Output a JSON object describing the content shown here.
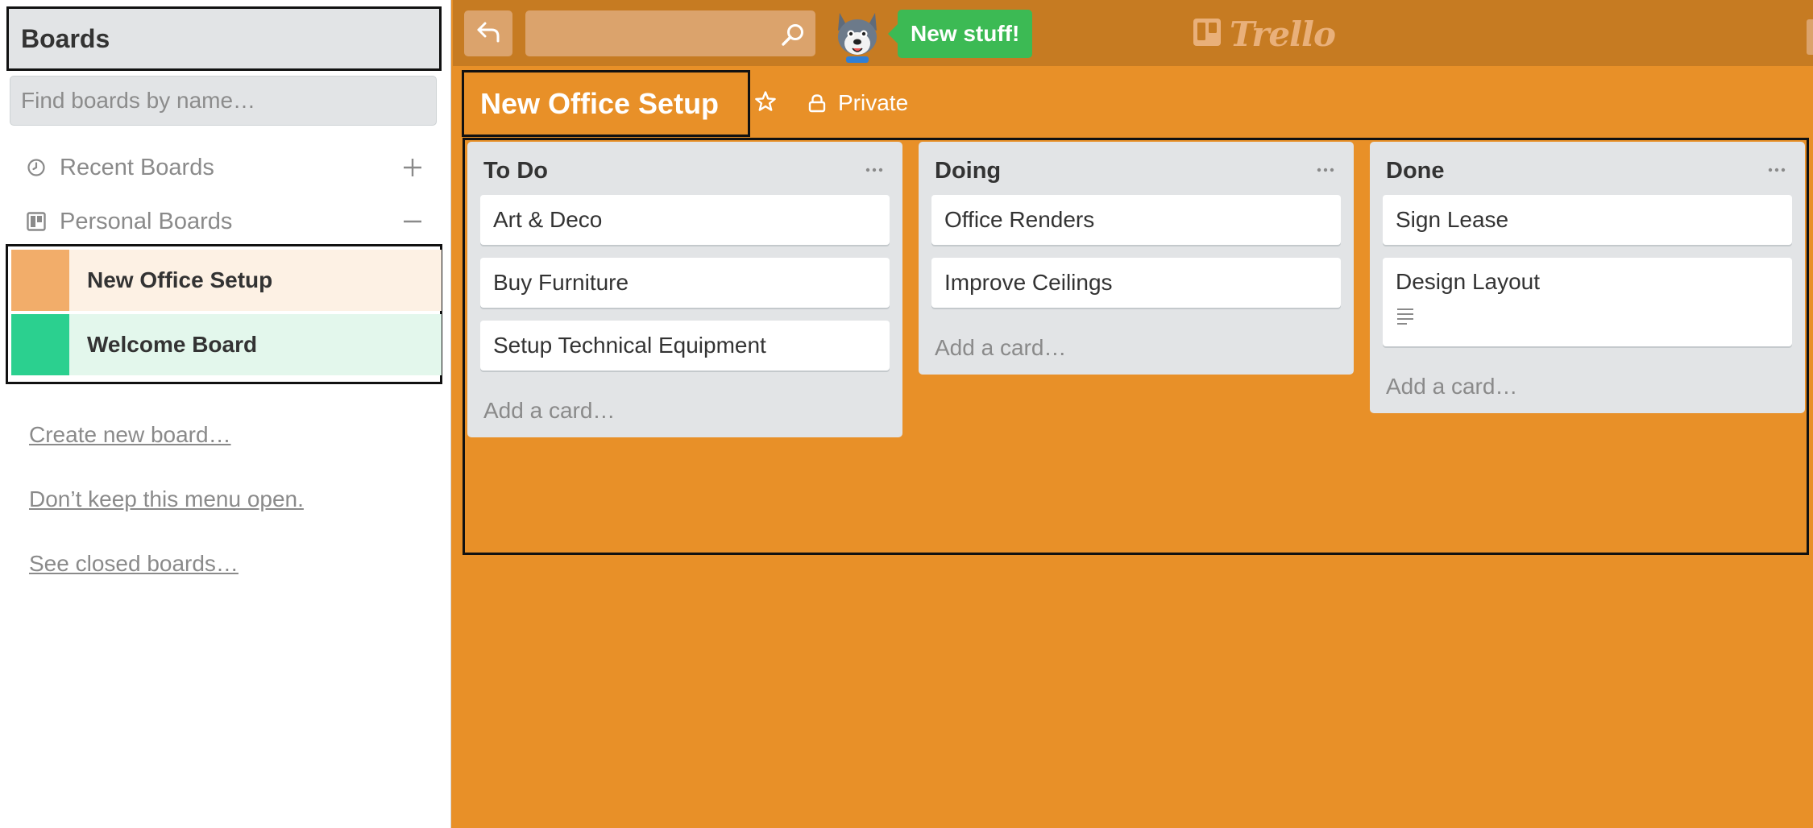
{
  "sidebar": {
    "title": "Boards",
    "search_placeholder": "Find boards by name…",
    "recent_label": "Recent Boards",
    "personal_label": "Personal Boards",
    "boards": [
      {
        "name": "New Office Setup",
        "color": "#f2ad6a"
      },
      {
        "name": "Welcome Board",
        "color": "#2bd08f"
      }
    ],
    "links": {
      "create": "Create new board…",
      "dont_keep": "Don’t keep this menu open.",
      "closed": "See closed boards…"
    }
  },
  "header": {
    "new_stuff_label": "New stuff!",
    "logo_text": "Trello",
    "search_value": ""
  },
  "board": {
    "title": "New Office Setup",
    "visibility": "Private",
    "background_color": "#e89028"
  },
  "lists": [
    {
      "title": "To Do",
      "cards": [
        "Art & Deco",
        "Buy Furniture",
        "Setup Technical Equipment"
      ],
      "add_label": "Add a card…"
    },
    {
      "title": "Doing",
      "cards": [
        "Office Renders",
        "Improve Ceilings"
      ],
      "add_label": "Add a card…"
    },
    {
      "title": "Done",
      "cards": [
        "Sign Lease",
        "Design Layout"
      ],
      "add_label": "Add a card…"
    }
  ],
  "icons": {
    "back": "arrow-back-icon",
    "search": "search-icon",
    "recent": "clock-icon",
    "personal": "board-icon",
    "add": "plus-icon",
    "collapse": "minus-icon",
    "star": "star-icon",
    "lock": "lock-icon",
    "list_menu": "ellipsis-icon",
    "description": "description-icon"
  }
}
